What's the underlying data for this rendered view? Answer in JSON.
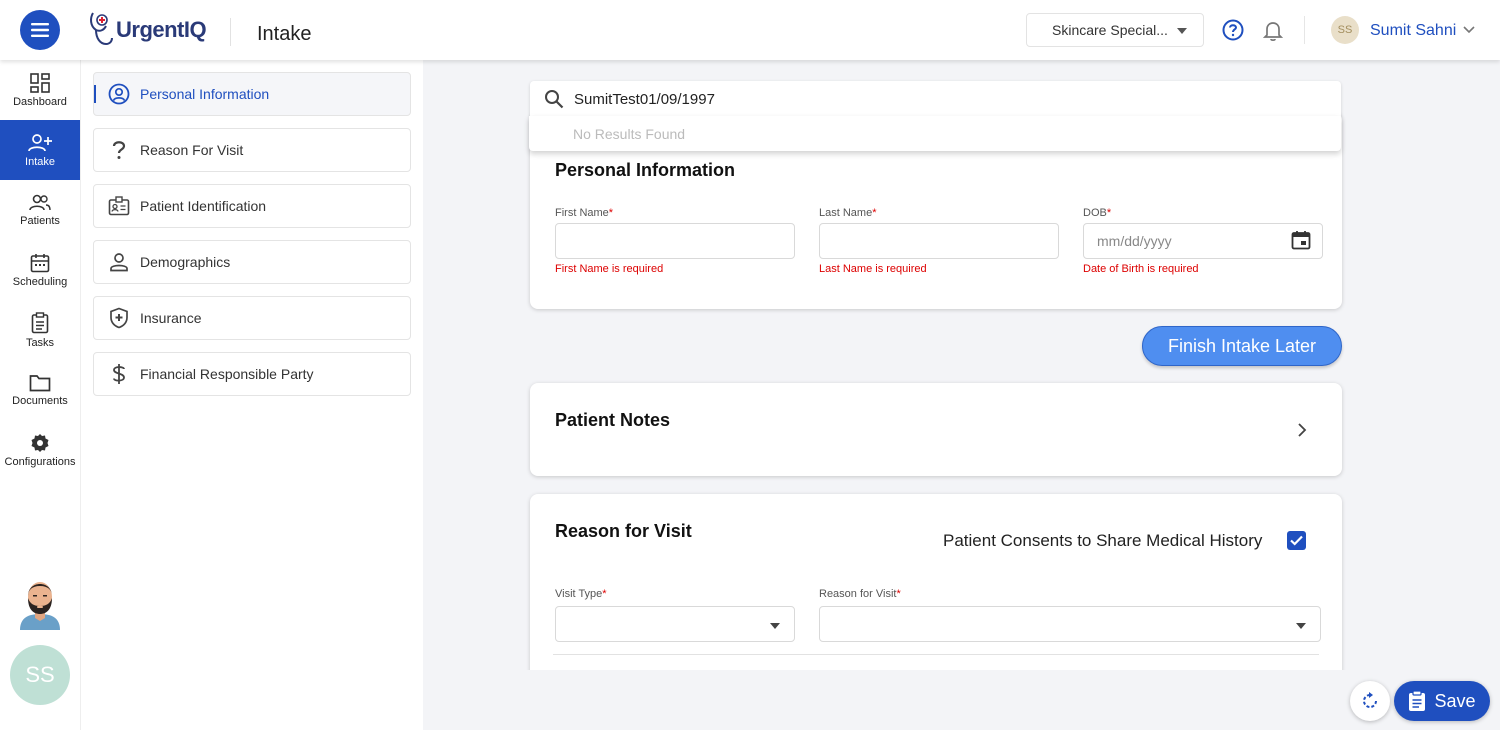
{
  "app": {
    "logo_text": "UrgentIQ",
    "page_title": "Intake"
  },
  "header": {
    "clinic_select": "Skincare Special...",
    "user_initials": "SS",
    "user_name": "Sumit Sahni"
  },
  "rail": {
    "items": [
      {
        "label": "Dashboard",
        "icon": "dashboard-icon"
      },
      {
        "label": "Intake",
        "icon": "add-user-icon",
        "active": true
      },
      {
        "label": "Patients",
        "icon": "patients-icon"
      },
      {
        "label": "Scheduling",
        "icon": "calendar-icon"
      },
      {
        "label": "Tasks",
        "icon": "clipboard-icon"
      },
      {
        "label": "Documents",
        "icon": "folder-icon"
      },
      {
        "label": "Configurations",
        "icon": "gear-icon"
      }
    ],
    "avatar_initials": "SS"
  },
  "sections": {
    "items": [
      {
        "label": "Personal Information",
        "icon": "user-circle-icon",
        "active": true
      },
      {
        "label": "Reason For Visit",
        "icon": "question-icon"
      },
      {
        "label": "Patient Identification",
        "icon": "id-card-icon"
      },
      {
        "label": "Demographics",
        "icon": "person-icon"
      },
      {
        "label": "Insurance",
        "icon": "shield-plus-icon"
      },
      {
        "label": "Financial Responsible Party",
        "icon": "dollar-icon"
      }
    ]
  },
  "search": {
    "value": "SumitTest01/09/1997",
    "no_results": "No Results Found"
  },
  "personal": {
    "title": "Personal Information",
    "first_name_label": "First Name",
    "last_name_label": "Last Name",
    "dob_label": "DOB",
    "required_mark": "*",
    "dob_placeholder": "mm/dd/yyyy",
    "first_name_error": "First Name is required",
    "last_name_error": "Last Name is required",
    "dob_error": "Date of Birth is required"
  },
  "actions": {
    "finish_later": "Finish Intake Later",
    "save": "Save"
  },
  "notes": {
    "title": "Patient Notes"
  },
  "reason": {
    "title": "Reason for Visit",
    "consent_label": "Patient Consents to Share Medical History",
    "consent_checked": true,
    "visit_type_label": "Visit Type",
    "reason_label": "Reason for Visit"
  },
  "colors": {
    "primary": "#1f4fbf",
    "accent_button": "#4f8ef0",
    "error": "#dd0000"
  }
}
